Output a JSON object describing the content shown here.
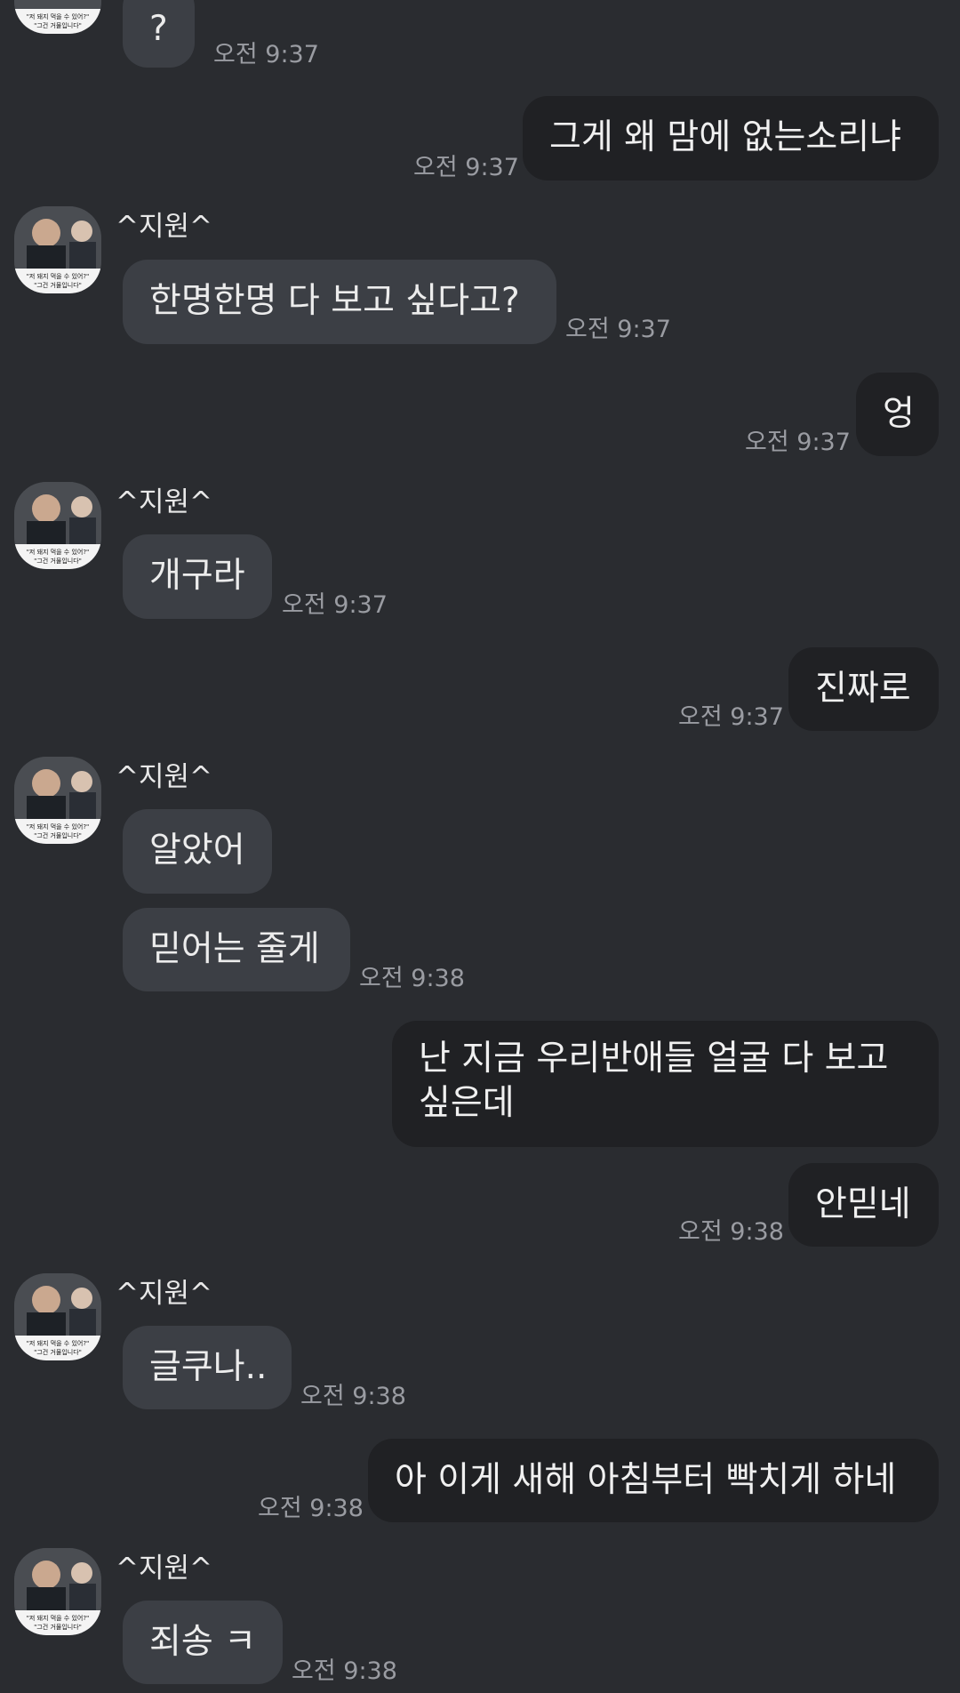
{
  "chat": {
    "messages": [
      {
        "id": "m1",
        "side": "in",
        "text": "?",
        "time": "오전 9:37"
      },
      {
        "id": "m2",
        "side": "out",
        "text": "그게 왜 맘에 없는소리냐",
        "time": "오전 9:37"
      },
      {
        "id": "m3",
        "side": "in",
        "sender": "^지원^",
        "text": "한명한명 다 보고 싶다고?",
        "time": "오전 9:37"
      },
      {
        "id": "m4",
        "side": "out",
        "text": "엉",
        "time": "오전 9:37"
      },
      {
        "id": "m5",
        "side": "in",
        "sender": "^지원^",
        "text": "개구라",
        "time": "오전 9:37"
      },
      {
        "id": "m6",
        "side": "out",
        "text": "진짜로",
        "time": "오전 9:37"
      },
      {
        "id": "m7",
        "side": "in",
        "sender": "^지원^",
        "text": "알았어"
      },
      {
        "id": "m8",
        "side": "in",
        "text": "믿어는 줄게",
        "time": "오전 9:38"
      },
      {
        "id": "m9",
        "side": "out",
        "text": "난 지금 우리반애들 얼굴 다 보고 싶은데"
      },
      {
        "id": "m10",
        "side": "out",
        "text": "안믿네",
        "time": "오전 9:38"
      },
      {
        "id": "m11",
        "side": "in",
        "sender": "^지원^",
        "text": "글쿠나..",
        "time": "오전 9:38"
      },
      {
        "id": "m12",
        "side": "out",
        "text": "아 이게 새해 아침부터 빡치게 하네",
        "time": "오전 9:38"
      },
      {
        "id": "m13",
        "side": "in",
        "sender": "^지원^",
        "text": "죄송 ㅋ",
        "time": "오전 9:38"
      }
    ],
    "avatar_caption_line1": "\"저 돼지 먹을 수 있어?\"",
    "avatar_caption_line2": "\"그건 거물입니다\""
  },
  "colors": {
    "background": "#2a2c30",
    "incoming_bubble": "#3c3f45",
    "outgoing_bubble": "#202124",
    "timestamp": "#9a9ca2"
  }
}
